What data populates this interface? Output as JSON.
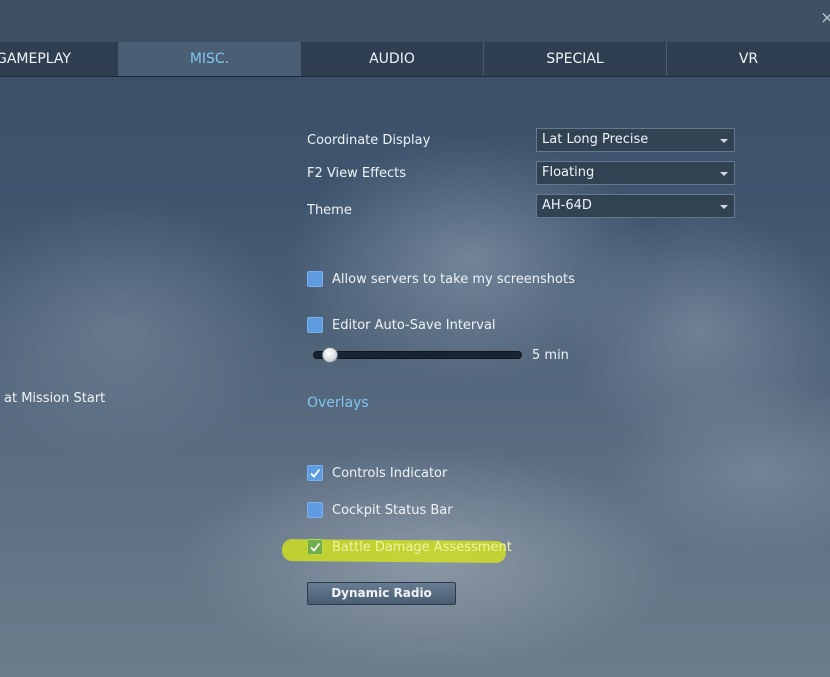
{
  "window": {
    "close_glyph": "×"
  },
  "tabs": [
    {
      "label": "GAMEPLAY",
      "active": false
    },
    {
      "label": "MISC.",
      "active": true
    },
    {
      "label": "AUDIO",
      "active": false
    },
    {
      "label": "SPECIAL",
      "active": false
    },
    {
      "label": "VR",
      "active": false
    }
  ],
  "left_partial": {
    "text": "at Mission Start"
  },
  "settings": {
    "coordinate_display": {
      "label": "Coordinate Display",
      "value": "Lat Long Precise"
    },
    "f2_view_effects": {
      "label": "F2 View Effects",
      "value": "Floating"
    },
    "theme": {
      "label": "Theme",
      "value": "AH-64D"
    },
    "allow_screenshots": {
      "label": "Allow servers to take my screenshots",
      "checked": false
    },
    "editor_autosave": {
      "label": "Editor Auto-Save Interval",
      "checked": false
    },
    "autosave_slider": {
      "value_text": "5 min",
      "value": 5
    }
  },
  "overlays": {
    "title": "Overlays",
    "controls_indicator": {
      "label": "Controls Indicator",
      "checked": true
    },
    "cockpit_status_bar": {
      "label": "Cockpit Status Bar",
      "checked": false
    },
    "battle_damage_assessment": {
      "label": "Battle Damage Assessment",
      "checked": true
    }
  },
  "buttons": {
    "dynamic_radio": "Dynamic Radio"
  },
  "colors": {
    "accent": "#7fc6ee",
    "checkbox": "#5f9be0",
    "highlight": "#dae812",
    "tab_bar": "#2f3f51",
    "tab_active": "#4a5f74"
  }
}
